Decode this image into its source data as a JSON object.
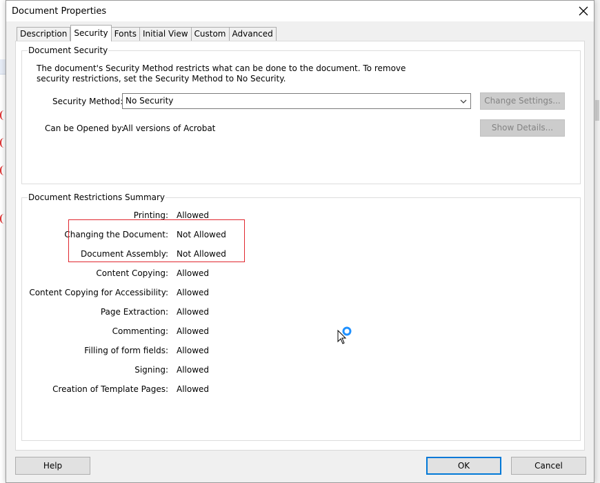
{
  "dialog": {
    "title": "Document Properties",
    "close_label": "close"
  },
  "tabs": [
    {
      "label": "Description"
    },
    {
      "label": "Security"
    },
    {
      "label": "Fonts"
    },
    {
      "label": "Initial View"
    },
    {
      "label": "Custom"
    },
    {
      "label": "Advanced"
    }
  ],
  "active_tab": "Security",
  "document_security": {
    "heading": "Document Security",
    "description_line1": "The document's Security Method restricts what can be done to the document. To remove",
    "description_line2": "security restrictions, set the Security Method to No Security.",
    "method_label": "Security Method:",
    "method_value": "No Security",
    "change_settings_label": "Change Settings...",
    "opened_by_label": "Can be Opened by:",
    "opened_by_value": "All versions of Acrobat",
    "show_details_label": "Show Details..."
  },
  "restrictions": {
    "heading": "Document Restrictions Summary",
    "rows": [
      {
        "label": "Printing:",
        "value": "Allowed"
      },
      {
        "label": "Changing the Document:",
        "value": "Not Allowed"
      },
      {
        "label": "Document Assembly:",
        "value": "Not Allowed"
      },
      {
        "label": "Content Copying:",
        "value": "Allowed"
      },
      {
        "label": "Content Copying for Accessibility:",
        "value": "Allowed"
      },
      {
        "label": "Page Extraction:",
        "value": "Allowed"
      },
      {
        "label": "Commenting:",
        "value": "Allowed"
      },
      {
        "label": "Filling of form fields:",
        "value": "Allowed"
      },
      {
        "label": "Signing:",
        "value": "Allowed"
      },
      {
        "label": "Creation of Template Pages:",
        "value": "Allowed"
      }
    ]
  },
  "footer": {
    "help_label": "Help",
    "ok_label": "OK",
    "cancel_label": "Cancel"
  },
  "colors": {
    "highlight": "#e0252c",
    "ok_border": "#0078d7",
    "cursor_ring": "#1e90ff"
  },
  "icons": {
    "close": "close-icon",
    "dropdown": "chevron-down-icon",
    "cursor": "busy-cursor-icon"
  }
}
